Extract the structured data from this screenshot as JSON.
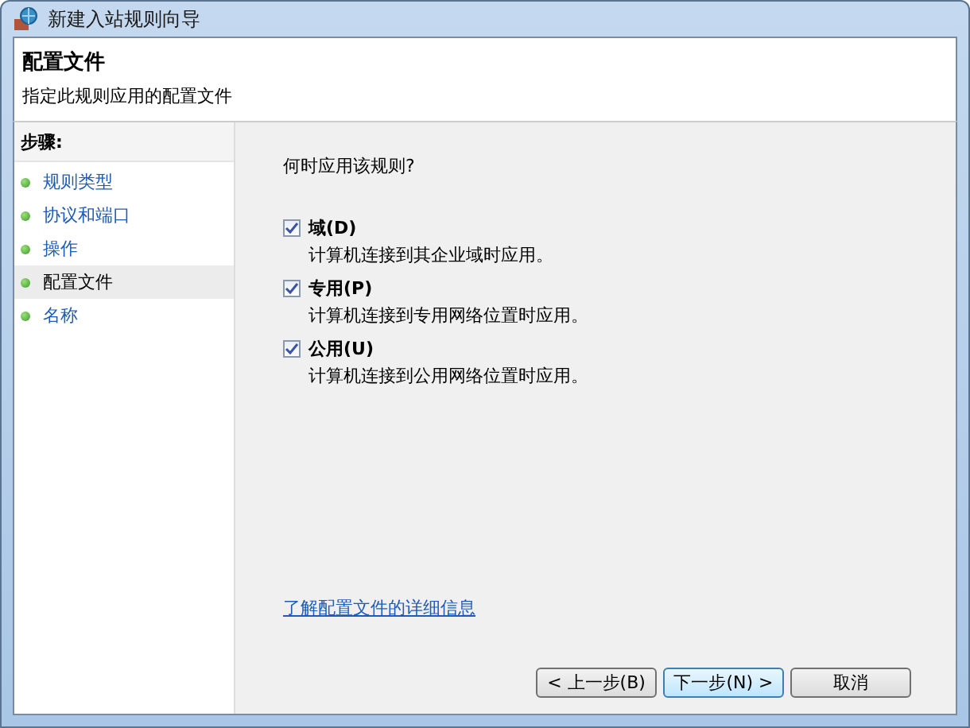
{
  "window": {
    "title": "新建入站规则向导"
  },
  "header": {
    "title": "配置文件",
    "subtitle": "指定此规则应用的配置文件"
  },
  "steps": {
    "heading": "步骤:",
    "items": [
      {
        "label": "规则类型",
        "selected": false
      },
      {
        "label": "协议和端口",
        "selected": false
      },
      {
        "label": "操作",
        "selected": false
      },
      {
        "label": "配置文件",
        "selected": true
      },
      {
        "label": "名称",
        "selected": false
      }
    ]
  },
  "question": "何时应用该规则?",
  "options": [
    {
      "label": "域(D)",
      "description": "计算机连接到其企业域时应用。",
      "checked": true
    },
    {
      "label": "专用(P)",
      "description": "计算机连接到专用网络位置时应用。",
      "checked": true
    },
    {
      "label": "公用(U)",
      "description": "计算机连接到公用网络位置时应用。",
      "checked": true
    }
  ],
  "link": "了解配置文件的详细信息",
  "buttons": [
    {
      "label": "< 上一步(B)",
      "default": false
    },
    {
      "label": "下一步(N) >",
      "default": true
    },
    {
      "label": "取消",
      "default": false
    }
  ]
}
